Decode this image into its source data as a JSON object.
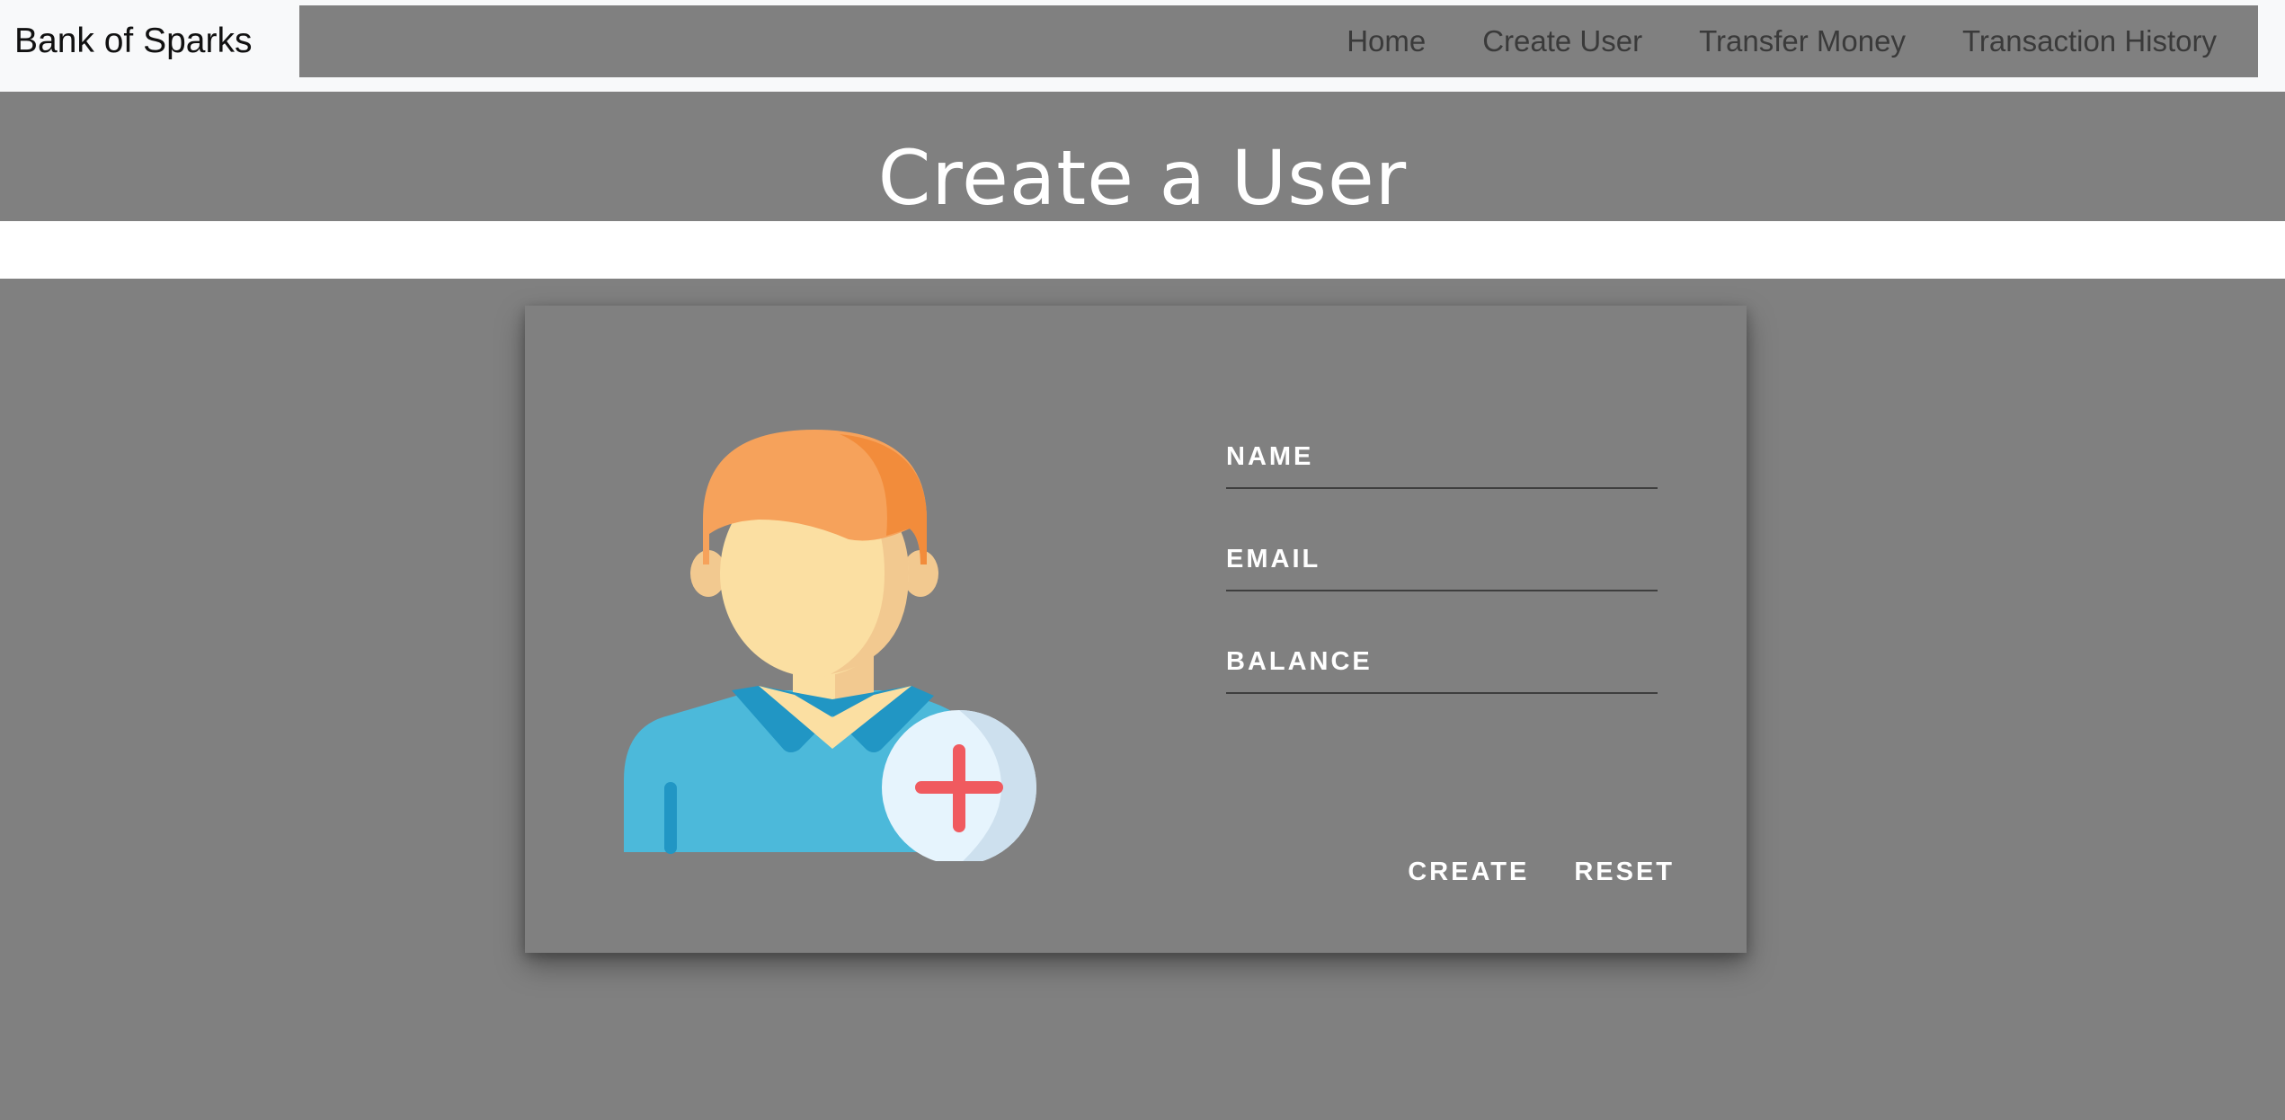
{
  "navbar": {
    "brand": "Bank of Sparks",
    "links": [
      {
        "label": "Home"
      },
      {
        "label": "Create User"
      },
      {
        "label": "Transfer Money"
      },
      {
        "label": "Transaction History"
      }
    ]
  },
  "hero": {
    "title": "Create a User"
  },
  "card": {
    "illustration_icon": "add-user-avatar-icon",
    "fields": [
      {
        "label": "NAME",
        "value": ""
      },
      {
        "label": "EMAIL",
        "value": ""
      },
      {
        "label": "BALANCE",
        "value": ""
      }
    ],
    "buttons": {
      "create": "CREATE",
      "reset": "RESET"
    }
  },
  "colors": {
    "page_bg": "#808080",
    "navbar_bg": "#f8f9fa",
    "band_bg": "#ffffff",
    "text_light": "#ffffff",
    "nav_text": "#3a3a3a",
    "hair": "#f6a25b",
    "skin": "#fbdfa2",
    "shirt": "#4cb9da",
    "plus": "#f05a5f"
  }
}
